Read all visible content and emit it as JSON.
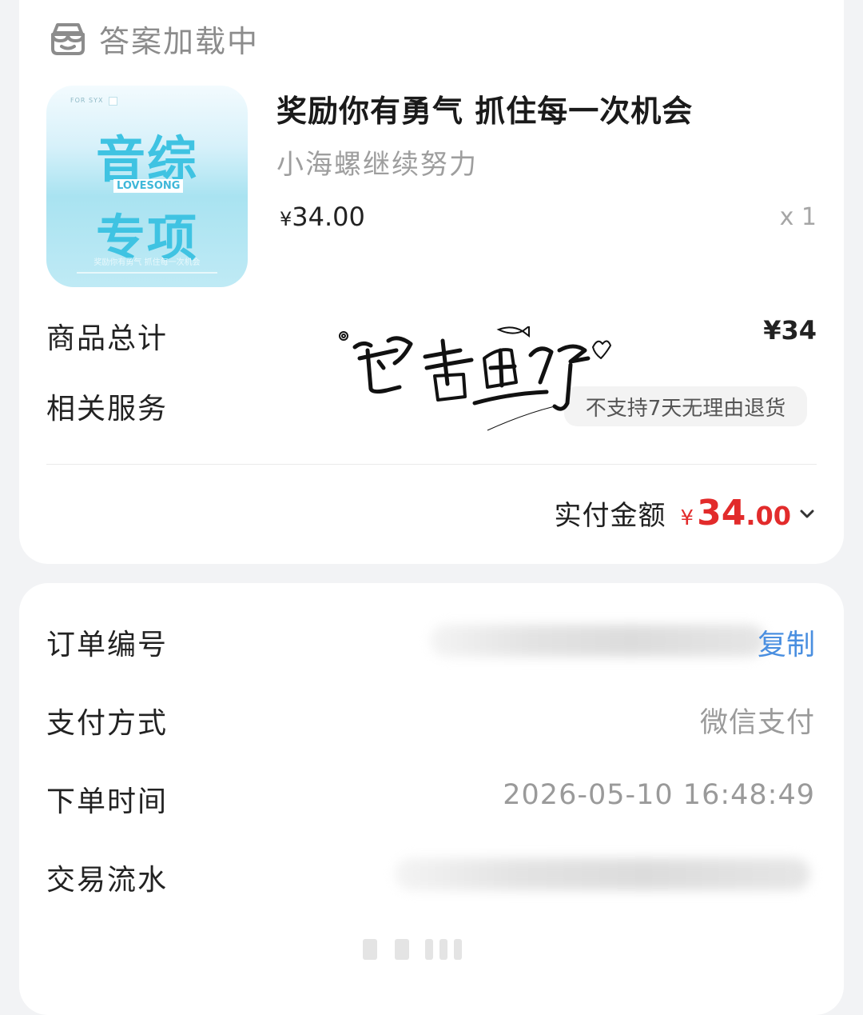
{
  "shop": {
    "icon": "shop-icon",
    "name": "答案加载中"
  },
  "product": {
    "image": {
      "tag": "FOR SYX",
      "line1": "音综",
      "badge": "LOVESONG",
      "line2": "专项",
      "caption": "奖励你有勇气 抓住每一次机会"
    },
    "title": "奖励你有勇气 抓住每一次机会",
    "subtitle": "小海螺继续努力",
    "price_symbol": "¥",
    "price": "34.00",
    "quantity": "x 1"
  },
  "summary": {
    "total_label": "商品总计",
    "total_value": "¥34",
    "service_label": "相关服务",
    "service_tag": "不支持7天无理由退货",
    "paid_label": "实付金额",
    "paid_symbol": "¥",
    "paid_int": "34",
    "paid_dec": ".00",
    "expand_icon": "chevron-down-icon"
  },
  "watermark": "酱香鱼仔",
  "colors": {
    "price_red": "#e22b2b",
    "link_blue": "#4a8fe0",
    "background": "#f2f3f5"
  },
  "order_info": {
    "order_no_label": "订单编号",
    "copy_label": "复制",
    "payment_label": "支付方式",
    "payment_value": "微信支付",
    "time_label": "下单时间",
    "time_value": "2026-05-10 16:48:49",
    "txn_label": "交易流水"
  }
}
